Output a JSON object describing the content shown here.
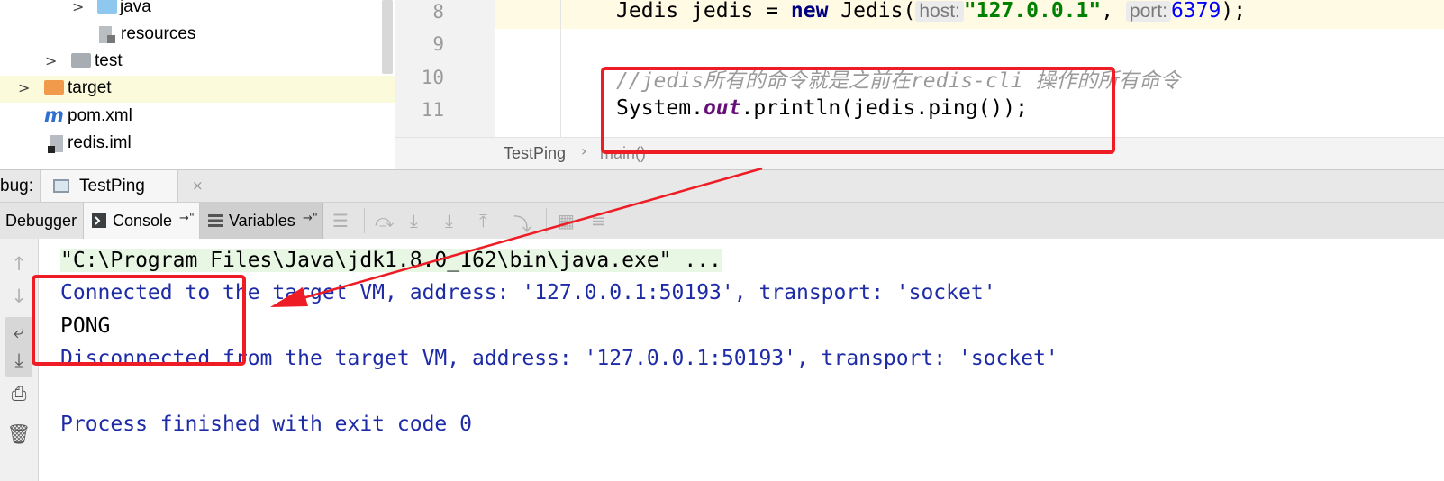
{
  "project_tree": {
    "items": [
      {
        "label": "java",
        "icon": "folder-blue-icon",
        "expand": ">"
      },
      {
        "label": "resources",
        "icon": "resources-folder-icon",
        "expand": ""
      },
      {
        "label": "test",
        "icon": "folder-gray-icon",
        "expand": ">"
      },
      {
        "label": "target",
        "icon": "folder-orange-icon",
        "expand": ">"
      },
      {
        "label": "pom.xml",
        "icon": "maven-icon",
        "icon_glyph": "m",
        "expand": ""
      },
      {
        "label": "redis.iml",
        "icon": "iml-file-icon",
        "expand": ""
      }
    ]
  },
  "editor": {
    "lines": [
      {
        "number": "8",
        "pre": "Jedis jedis = ",
        "kw": "new",
        "mid": " Jedis(",
        "hint_host": "host:",
        "arg_host": "\"127.0.0.1\"",
        "comma": ", ",
        "hint_port": "port:",
        "arg_port": "6379",
        "post": ");"
      },
      {
        "number": "9"
      },
      {
        "number": "10",
        "comment": "//jedis所有的命令就是之前在redis-cli 操作的所有命令"
      },
      {
        "number": "11",
        "pre": "System.",
        "field": "out",
        "post": ".println(jedis.ping());"
      }
    ],
    "breadcrumb": {
      "class": "TestPing",
      "separator": "›",
      "method": "main()"
    }
  },
  "debug": {
    "label": "bug:",
    "session_tab": "TestPing",
    "close_glyph": "×",
    "toolbar": {
      "debugger": "Debugger",
      "console": "Console",
      "variables": "Variables",
      "pin_glyph": "→\""
    }
  },
  "console": {
    "lines": [
      "\"C:\\Program Files\\Java\\jdk1.8.0_162\\bin\\java.exe\" ...",
      "Connected to the target VM, address: '127.0.0.1:50193', transport: 'socket'",
      "PONG",
      "Disconnected from the target VM, address: '127.0.0.1:50193', transport: 'socket'",
      "",
      "Process finished with exit code 0"
    ]
  },
  "colors": {
    "annotation_red": "#ee1c24",
    "console_blue": "#1e2ba6",
    "keyword_navy": "#000080",
    "string_green": "#008000",
    "number_blue": "#0000ff",
    "field_purple": "#660e7a"
  }
}
